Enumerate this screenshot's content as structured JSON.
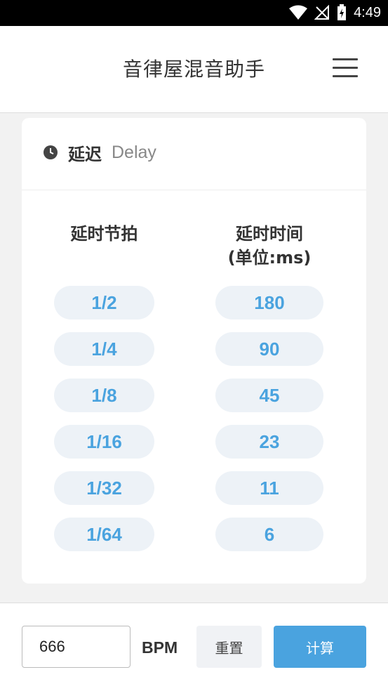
{
  "status_bar": {
    "time": "4:49"
  },
  "app_bar": {
    "title": "音律屋混音助手"
  },
  "card": {
    "title": "延迟",
    "subtitle": "Delay",
    "column_left_header": "延时节拍",
    "column_right_header_line1": "延时时间",
    "column_right_header_line2": "(单位:ms)",
    "rows": [
      {
        "beat": "1/2",
        "ms": "180"
      },
      {
        "beat": "1/4",
        "ms": "90"
      },
      {
        "beat": "1/8",
        "ms": "45"
      },
      {
        "beat": "1/16",
        "ms": "23"
      },
      {
        "beat": "1/32",
        "ms": "11"
      },
      {
        "beat": "1/64",
        "ms": "6"
      }
    ]
  },
  "controls": {
    "bpm_value": "666",
    "bpm_label": "BPM",
    "reset_label": "重置",
    "calculate_label": "计算"
  },
  "colors": {
    "accent": "#4aa3df",
    "pill_bg": "#edf2f7"
  }
}
